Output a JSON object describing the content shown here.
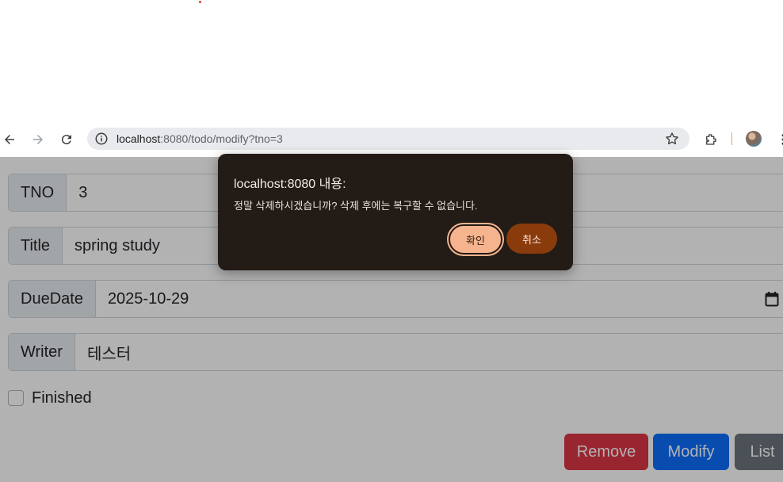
{
  "browser": {
    "url_host": "localhost",
    "url_path": ":8080/todo/modify?tno=3"
  },
  "form": {
    "tno_label": "TNO",
    "tno_value": "3",
    "title_label": "Title",
    "title_value": "spring study",
    "duedate_label": "DueDate",
    "duedate_value": "2025-10-29",
    "writer_label": "Writer",
    "writer_value": "테스터",
    "finished_label": "Finished"
  },
  "buttons": {
    "remove": "Remove",
    "modify": "Modify",
    "list": "List"
  },
  "dialog": {
    "title": "localhost:8080 내용:",
    "message": "정말 삭제하시겠습니까? 삭제 후에는 복구할 수 없습니다.",
    "ok_label": "확인",
    "cancel_label": "취소"
  },
  "colors": {
    "remove": "#dc3545",
    "modify": "#0d6efd",
    "list": "#6c757d",
    "dialog_bg": "#231b16",
    "ok_button": "#f5b48e",
    "cancel_button": "#8a3b0c"
  }
}
